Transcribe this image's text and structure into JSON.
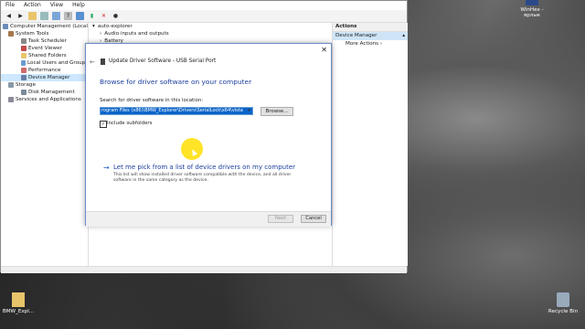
{
  "menu": [
    "File",
    "Action",
    "View",
    "Help"
  ],
  "tree": {
    "items": [
      {
        "label": "Computer Management (Local",
        "level": 0
      },
      {
        "label": "System Tools",
        "level": 1
      },
      {
        "label": "Task Scheduler",
        "level": 2
      },
      {
        "label": "Event Viewer",
        "level": 2
      },
      {
        "label": "Shared Folders",
        "level": 2
      },
      {
        "label": "Local Users and Groups",
        "level": 2
      },
      {
        "label": "Performance",
        "level": 2
      },
      {
        "label": "Device Manager",
        "level": 2
      },
      {
        "label": "Storage",
        "level": 1
      },
      {
        "label": "Disk Management",
        "level": 2
      },
      {
        "label": "Services and Applications",
        "level": 1
      }
    ]
  },
  "center": {
    "items": [
      "auto-explorer",
      "Audio inputs and outputs",
      "Battery"
    ]
  },
  "actions": {
    "header": "Actions",
    "selected": "Device Manager",
    "more": "More Actions"
  },
  "dialog": {
    "title": "Update Driver Software - USB Serial Port",
    "heading": "Browse for driver software on your computer",
    "search_label": "Search for driver software in this location:",
    "path_value": "rogram Files (x86)\\BMW_Explorer\\Drivers\\SerialLock\\x64\\vista",
    "browse_label": "Browse...",
    "include_subfolders_label": "Include subfolders",
    "include_subfolders_checked": true,
    "pick_title": "Let me pick from a list of device drivers on my computer",
    "pick_desc": "This list will show installed driver software compatible with the device, and all driver software in the same category as the device.",
    "next_label": "Next",
    "cancel_label": "Cancel"
  },
  "desktop": {
    "top_right_label": "WinHex - ярлык",
    "bottom_left_label": "BMW_Expl...",
    "recycle_label": "Recycle Bin"
  },
  "colors": {
    "accent": "#1a3e9e",
    "selection": "#0a64c8",
    "highlight": "#ffde00"
  }
}
